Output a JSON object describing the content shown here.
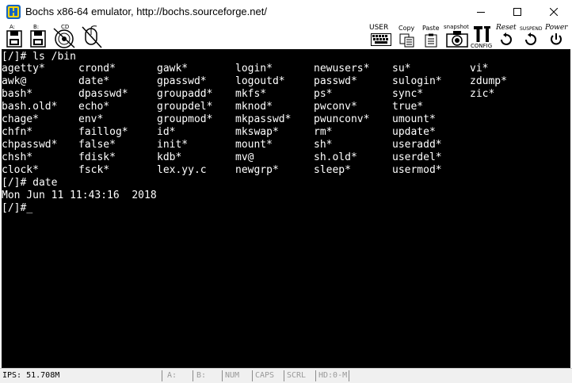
{
  "window": {
    "title": "Bochs x86-64 emulator, http://bochs.sourceforge.net/"
  },
  "toolbar": {
    "floppy_a_label": "A:",
    "floppy_b_label": "B:",
    "cdrom_label": "CD",
    "user_label": "USER",
    "copy_label": "Copy",
    "paste_label": "Paste",
    "snapshot_label": "snapshot",
    "config_label": "CONFIG",
    "reset_label": "Reset",
    "suspend_label": "SUSPEND",
    "power_label": "Power"
  },
  "terminal": {
    "prompt1": "[/]# ls /bin",
    "listing": [
      [
        "agetty*",
        "crond*",
        "gawk*",
        "login*",
        "newusers*",
        "su*",
        "vi*"
      ],
      [
        "awk@",
        "date*",
        "gpasswd*",
        "logoutd*",
        "passwd*",
        "sulogin*",
        "zdump*"
      ],
      [
        "bash*",
        "dpasswd*",
        "groupadd*",
        "mkfs*",
        "ps*",
        "sync*",
        "zic*"
      ],
      [
        "bash.old*",
        "echo*",
        "groupdel*",
        "mknod*",
        "pwconv*",
        "true*",
        ""
      ],
      [
        "chage*",
        "env*",
        "groupmod*",
        "mkpasswd*",
        "pwunconv*",
        "umount*",
        ""
      ],
      [
        "chfn*",
        "faillog*",
        "id*",
        "mkswap*",
        "rm*",
        "update*",
        ""
      ],
      [
        "chpasswd*",
        "false*",
        "init*",
        "mount*",
        "sh*",
        "useradd*",
        ""
      ],
      [
        "chsh*",
        "fdisk*",
        "kdb*",
        "mv@",
        "sh.old*",
        "userdel*",
        ""
      ],
      [
        "clock*",
        "fsck*",
        "lex.yy.c",
        "newgrp*",
        "sleep*",
        "usermod*",
        ""
      ]
    ],
    "prompt2": "[/]# date",
    "date_output": "Mon Jun 11 11:43:16  2018",
    "prompt3": "[/]#",
    "cursor": "_"
  },
  "status": {
    "ips": "IPS: 51.708M",
    "a": "A:",
    "b": "B:",
    "num": "NUM",
    "caps": "CAPS",
    "scrl": "SCRL",
    "hd": "HD:0-M"
  },
  "colors": {
    "terminal_bg": "#000000",
    "terminal_fg": "#ffffff",
    "status_bg": "#f0f0f0"
  }
}
